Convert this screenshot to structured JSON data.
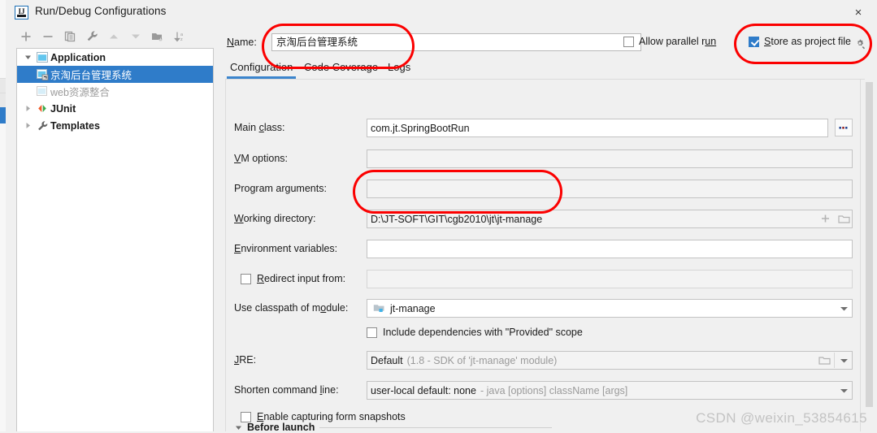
{
  "window": {
    "title": "Run/Debug Configurations",
    "app_icon": "intellij-idea-icon",
    "close_label": "×"
  },
  "toolbar": {
    "buttons": [
      {
        "name": "add-configuration-button",
        "icon": "plus-icon",
        "label": "+"
      },
      {
        "name": "remove-configuration-button",
        "icon": "minus-icon",
        "label": "−"
      },
      {
        "name": "copy-configuration-button",
        "icon": "copy-icon",
        "label": "Copy"
      },
      {
        "name": "edit-templates-button",
        "icon": "wrench-icon",
        "label": "Edit Templates"
      },
      {
        "name": "move-up-button",
        "icon": "arrow-up-icon",
        "label": "Move Up"
      },
      {
        "name": "move-down-button",
        "icon": "arrow-down-icon",
        "label": "Move Down"
      },
      {
        "name": "new-folder-button",
        "icon": "folder-add-icon",
        "label": "New Folder"
      },
      {
        "name": "sort-configurations-button",
        "icon": "sort-az-icon",
        "label": "Sort Configurations"
      }
    ]
  },
  "tree": {
    "items": [
      {
        "label": "Application",
        "icon": "application-icon",
        "twisty": "expanded",
        "level": 0,
        "bold": true,
        "selected": false,
        "muted": false
      },
      {
        "label": "京淘后台管理系统",
        "icon": "run-config-icon",
        "twisty": "none",
        "level": 1,
        "bold": false,
        "selected": true,
        "muted": false
      },
      {
        "label": "web资源整合",
        "icon": "run-config-icon",
        "twisty": "none",
        "level": 1,
        "bold": false,
        "selected": false,
        "muted": true
      },
      {
        "label": "JUnit",
        "icon": "junit-icon",
        "twisty": "collapsed",
        "level": 0,
        "bold": true,
        "selected": false,
        "muted": false
      },
      {
        "label": "Templates",
        "icon": "wrench-icon",
        "twisty": "collapsed",
        "level": 0,
        "bold": true,
        "selected": false,
        "muted": false
      }
    ]
  },
  "header": {
    "name_label": "Name:",
    "name_label_mnemonic": "N",
    "name_value": "京淘后台管理系统",
    "allow_parallel_run_label": "Allow parallel run",
    "allow_parallel_run_mnemonic": "un",
    "allow_parallel_run_checked": false,
    "store_as_project_file_label": "Store as project file",
    "store_as_project_file_mnemonic": "S",
    "store_as_project_file_checked": true,
    "gear_icon": "gear-icon"
  },
  "tabs": [
    {
      "label": "Configuration",
      "active": true
    },
    {
      "label": "Code Coverage",
      "active": false
    },
    {
      "label": "Logs",
      "active": false
    }
  ],
  "form": {
    "main_class": {
      "label": "Main class:",
      "value": "com.jt.SpringBootRun",
      "browse_button": "...",
      "browse_icon": "ellipsis-icon"
    },
    "vm_options": {
      "label": "VM options:",
      "value": "",
      "icons": [
        "plus-icon",
        "expand-icon"
      ]
    },
    "program_arguments": {
      "label": "Program arguments:",
      "value": "",
      "icons": [
        "plus-icon",
        "expand-icon"
      ]
    },
    "working_directory": {
      "label": "Working directory:",
      "value": "D:\\JT-SOFT\\GIT\\cgb2010\\jt\\jt-manage",
      "icons": [
        "plus-icon",
        "folder-icon"
      ]
    },
    "environment_variables": {
      "label": "Environment variables:",
      "value": "",
      "icons": [
        "list-icon"
      ]
    },
    "redirect_input": {
      "label": "Redirect input from:",
      "mnemonic": "R",
      "checked": false,
      "value": "",
      "icons": [
        "plus-icon",
        "folder-icon"
      ]
    },
    "use_classpath_of_module": {
      "label": "Use classpath of module:",
      "value": "jt-manage",
      "icon": "module-icon",
      "dropdown_icon": "chevron-down-icon"
    },
    "include_provided": {
      "label": "Include dependencies with \"Provided\" scope",
      "checked": false
    },
    "jre": {
      "label": "JRE:",
      "mnemonic": "J",
      "value": "Default",
      "value_hint": "(1.8 - SDK of 'jt-manage' module)",
      "icons": [
        "folder-icon",
        "chevron-down-icon"
      ]
    },
    "shorten_command_line": {
      "label": "Shorten command line:",
      "value": "user-local default: none",
      "value_hint": "- java [options] className [args]",
      "dropdown_icon": "chevron-down-icon"
    },
    "enable_capturing": {
      "label": "Enable capturing form snapshots",
      "checked": false
    }
  },
  "before_launch": {
    "label": "Before launch",
    "twisty": "expanded"
  },
  "annotations": {
    "color": "#fb0000",
    "boxes": [
      "name-field",
      "store-as-project-file",
      "working-directory"
    ]
  },
  "watermark": "CSDN @weixin_53854615",
  "colors": {
    "accent": "#2f7cc9",
    "tab_underline": "#3c85cd",
    "annotation": "#fb0000",
    "panel_bg": "#f0f0f0",
    "field_bg": "#ffffff"
  }
}
